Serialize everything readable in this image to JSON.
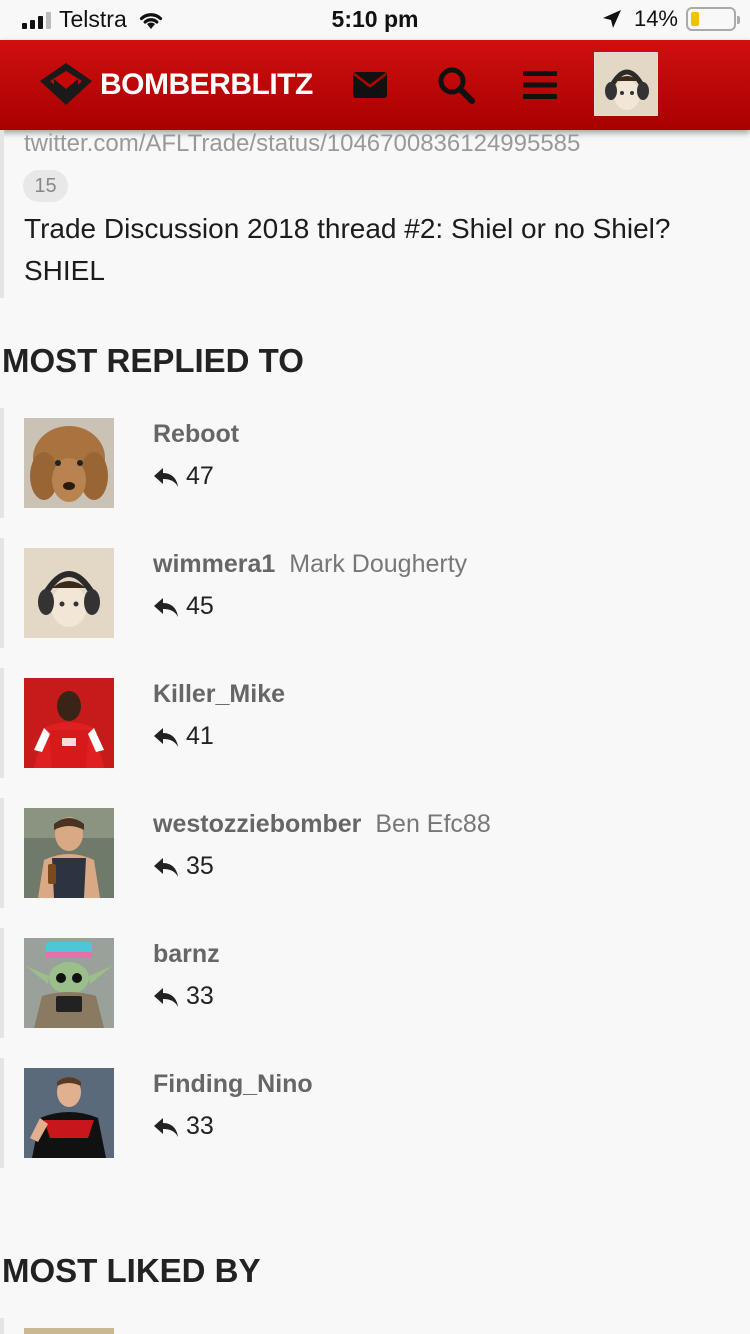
{
  "status_bar": {
    "carrier": "Telstra",
    "time": "5:10 pm",
    "battery": "14%"
  },
  "header": {
    "brand": "BOMBERBLITZ",
    "icons": [
      "envelope-icon",
      "search-icon",
      "menu-icon"
    ]
  },
  "post": {
    "link": "twitter.com/AFLTrade/status/1046700836124995585",
    "count": "15",
    "thread_title": "Trade Discussion 2018 thread #2: Shiel or no Shiel? SHIEL"
  },
  "most_replied": {
    "title": "MOST REPLIED TO",
    "users": [
      {
        "username": "Reboot",
        "real_name": "",
        "count": "47"
      },
      {
        "username": "wimmera1",
        "real_name": "Mark Dougherty",
        "count": "45"
      },
      {
        "username": "Killer_Mike",
        "real_name": "",
        "count": "41"
      },
      {
        "username": "westozziebomber",
        "real_name": "Ben Efc88",
        "count": "35"
      },
      {
        "username": "barnz",
        "real_name": "",
        "count": "33"
      },
      {
        "username": "Finding_Nino",
        "real_name": "",
        "count": "33"
      }
    ]
  },
  "most_liked": {
    "title": "MOST LIKED BY"
  },
  "colors": {
    "brand_red": "#c40808",
    "background": "#f8f8f8"
  }
}
